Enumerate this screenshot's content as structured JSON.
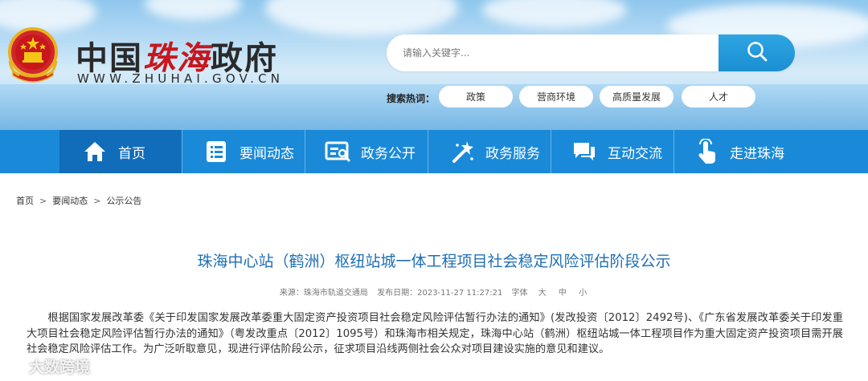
{
  "header": {
    "logo_text_black_1": "中国",
    "logo_text_red": "珠海",
    "logo_text_black_2": "政府",
    "logo_url": "WWW.ZHUHAI.GOV.CN",
    "search": {
      "placeholder": "请输入关键字..."
    },
    "hot_label": "搜索热词：",
    "hot_tags": [
      "政策",
      "营商环境",
      "高质量发展",
      "人才"
    ]
  },
  "nav": {
    "items": [
      {
        "label": "首页",
        "icon": "home-icon"
      },
      {
        "label": "要闻动态",
        "icon": "news-list-icon"
      },
      {
        "label": "政务公开",
        "icon": "disclosure-icon"
      },
      {
        "label": "政务服务",
        "icon": "service-wand-icon"
      },
      {
        "label": "互动交流",
        "icon": "chat-icon"
      },
      {
        "label": "走进珠海",
        "icon": "tap-hand-icon"
      }
    ]
  },
  "breadcrumb": [
    "首页",
    "要闻动态",
    "公示公告"
  ],
  "article": {
    "title": "珠海中心站（鹤洲）枢纽站城一体工程项目社会稳定风险评估阶段公示",
    "source": "来源：珠海市轨道交通局",
    "date": "发布日期：2023-11-27 11:27:21",
    "font_label": "字体",
    "font_sizes": [
      "大",
      "中",
      "小"
    ],
    "body": "根据国家发展改革委《关于印发国家发展改革委重大固定资产投资项目社会稳定风险评估暂行办法的通知》(发改投资〔2012〕2492号)、《广东省发展改革委关于印发重大项目社会稳定风险评估暂行办法的通知》（粤发改重点〔2012〕1095号）和珠海市相关规定，珠海中心站（鹤洲）枢纽站城一体工程项目作为重大固定资产投资项目需开展社会稳定风险评估工作。为广泛听取意见，现进行评估阶段公示，征求项目沿线两侧社会公众对项目建设实施的意见和建议。"
  },
  "watermark": "大数跨境",
  "colors": {
    "nav_bg": "#1a8ad8",
    "nav_active": "#116db9",
    "title_blue": "#1f6fb5",
    "logo_red": "#c8161d"
  }
}
